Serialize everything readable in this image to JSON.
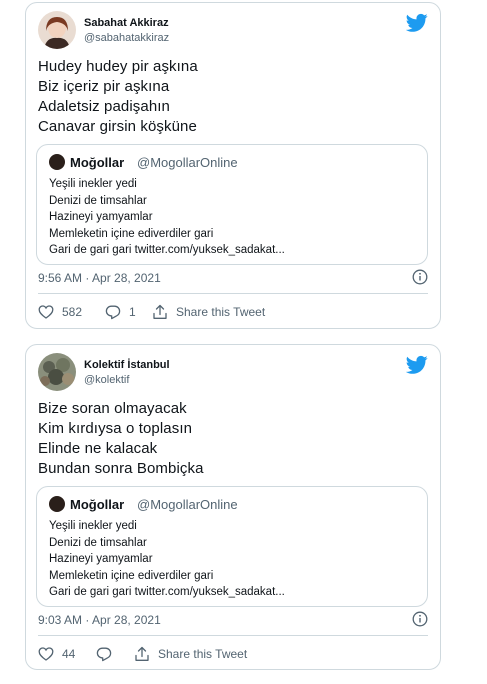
{
  "tweets": [
    {
      "author": {
        "name": "Sabahat Akkiraz",
        "handle": "@sabahatakkiraz"
      },
      "text_lines": [
        "Hudey hudey pir aşkına",
        "Biz içeriz pir aşkına",
        "Adaletsiz padişahın",
        "Canavar girsin köşküne"
      ],
      "quote": {
        "name": "Moğollar",
        "handle": "@MogollarOnline",
        "lines": [
          "Yeşili inekler yedi",
          "Denizi de timsahlar",
          "Hazineyi yamyamlar",
          "Memleketin içine ediverdiler gari",
          "Gari de gari gari twitter.com/yuksek_sadakat..."
        ]
      },
      "timestamp": "9:56 AM · Apr 28, 2021",
      "likes": "582",
      "replies": "1",
      "share_label": "Share this Tweet"
    },
    {
      "author": {
        "name": "Kolektif İstanbul",
        "handle": "@kolektif"
      },
      "text_lines": [
        "Bize soran olmayacak",
        "Kim kırdıysa o toplasın",
        "Elinde ne kalacak",
        "Bundan sonra Bombiçka"
      ],
      "quote": {
        "name": "Moğollar",
        "handle": "@MogollarOnline",
        "lines": [
          "Yeşili inekler yedi",
          "Denizi de timsahlar",
          "Hazineyi yamyamlar",
          "Memleketin içine ediverdiler gari",
          "Gari de gari gari twitter.com/yuksek_sadakat..."
        ]
      },
      "timestamp": "9:03 AM · Apr 28, 2021",
      "likes": "44",
      "replies": "",
      "share_label": "Share this Tweet"
    }
  ],
  "colors": {
    "twitter_blue": "#1d9bf0",
    "text": "#0f1419",
    "secondary": "#536471",
    "border": "#cfd9de"
  },
  "icons": [
    "twitter-bird-icon",
    "info-icon",
    "heart-icon",
    "reply-icon",
    "share-icon"
  ]
}
